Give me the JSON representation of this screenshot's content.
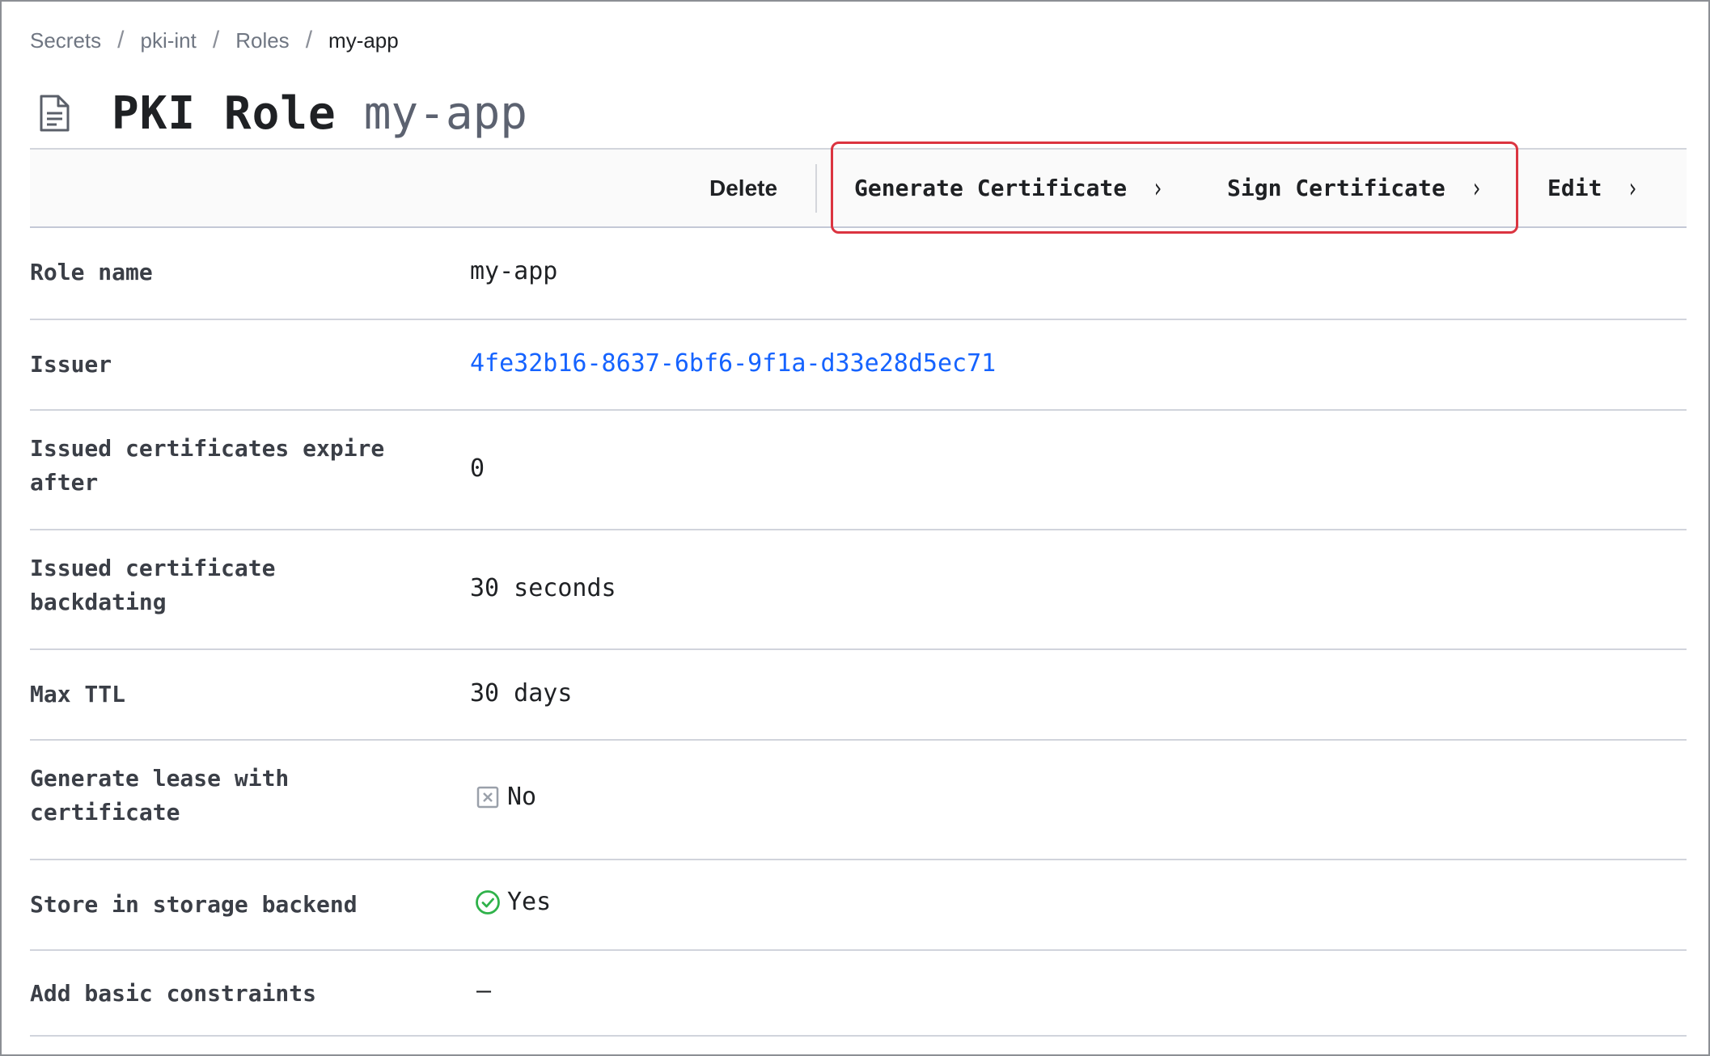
{
  "breadcrumb": {
    "items": [
      "Secrets",
      "pki-int",
      "Roles"
    ],
    "separator": "/",
    "current": "my-app"
  },
  "header": {
    "icon": "document-icon",
    "title": "PKI Role",
    "subtitle": "my-app"
  },
  "toolbar": {
    "delete_label": "Delete",
    "generate_label": "Generate Certificate",
    "sign_label": "Sign Certificate",
    "edit_label": "Edit",
    "chevron": "›",
    "highlight_color": "#db3440"
  },
  "details": {
    "role_name": {
      "label": "Role name",
      "value": "my-app"
    },
    "issuer": {
      "label": "Issuer",
      "value": "4fe32b16-8637-6bf6-9f1a-d33e28d5ec71"
    },
    "expire_after": {
      "label": "Issued certificates expire after",
      "value": "0"
    },
    "backdating": {
      "label": "Issued certificate backdating",
      "value": "30 seconds"
    },
    "max_ttl": {
      "label": "Max TTL",
      "value": "30 days"
    },
    "generate_lease": {
      "label": "Generate lease with certificate",
      "value": "No",
      "icon": "x-square-icon"
    },
    "store_backend": {
      "label": "Store in storage backend",
      "value": "Yes",
      "icon": "check-circle-icon"
    },
    "basic_constraints": {
      "label": "Add basic constraints",
      "value": "—"
    }
  },
  "colors": {
    "link": "#1563ff",
    "check": "#2fb24a",
    "x_icon": "#9aa0aa"
  }
}
